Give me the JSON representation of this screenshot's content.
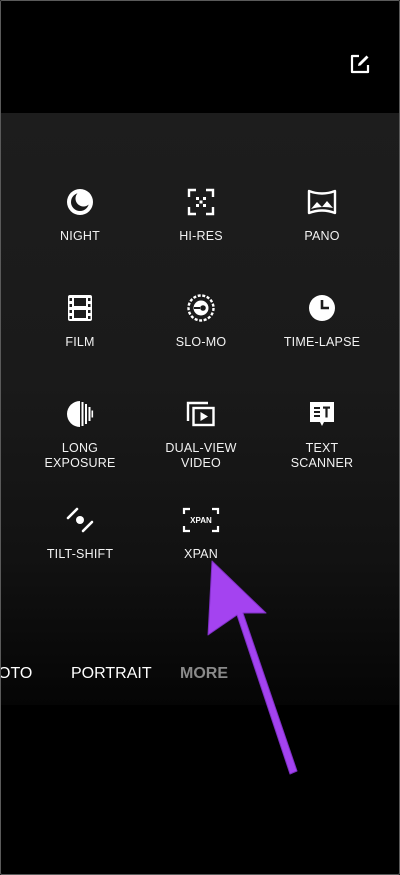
{
  "camera": {
    "edit_icon": "edit-icon",
    "modes": [
      {
        "label": "NIGHT",
        "icon": "night-icon"
      },
      {
        "label": "HI-RES",
        "icon": "hi-res-icon"
      },
      {
        "label": "PANO",
        "icon": "pano-icon"
      },
      {
        "label": "FILM",
        "icon": "film-icon"
      },
      {
        "label": "SLO-MO",
        "icon": "slo-mo-icon"
      },
      {
        "label": "TIME-LAPSE",
        "icon": "time-lapse-icon"
      },
      {
        "label": "LONG\nEXPOSURE",
        "icon": "long-exposure-icon"
      },
      {
        "label": "DUAL-VIEW\nVIDEO",
        "icon": "dual-view-video-icon"
      },
      {
        "label": "TEXT\nSCANNER",
        "icon": "text-scanner-icon"
      },
      {
        "label": "TILT-SHIFT",
        "icon": "tilt-shift-icon"
      },
      {
        "label": "XPAN",
        "icon": "xpan-icon"
      }
    ],
    "xpan_icon_text": "XPAN",
    "mode_tabs": [
      {
        "label": "OTO",
        "active": false
      },
      {
        "label": "PORTRAIT",
        "active": false
      },
      {
        "label": "MORE",
        "active": true
      }
    ]
  },
  "annotation": {
    "arrow_color": "#a443f0"
  }
}
